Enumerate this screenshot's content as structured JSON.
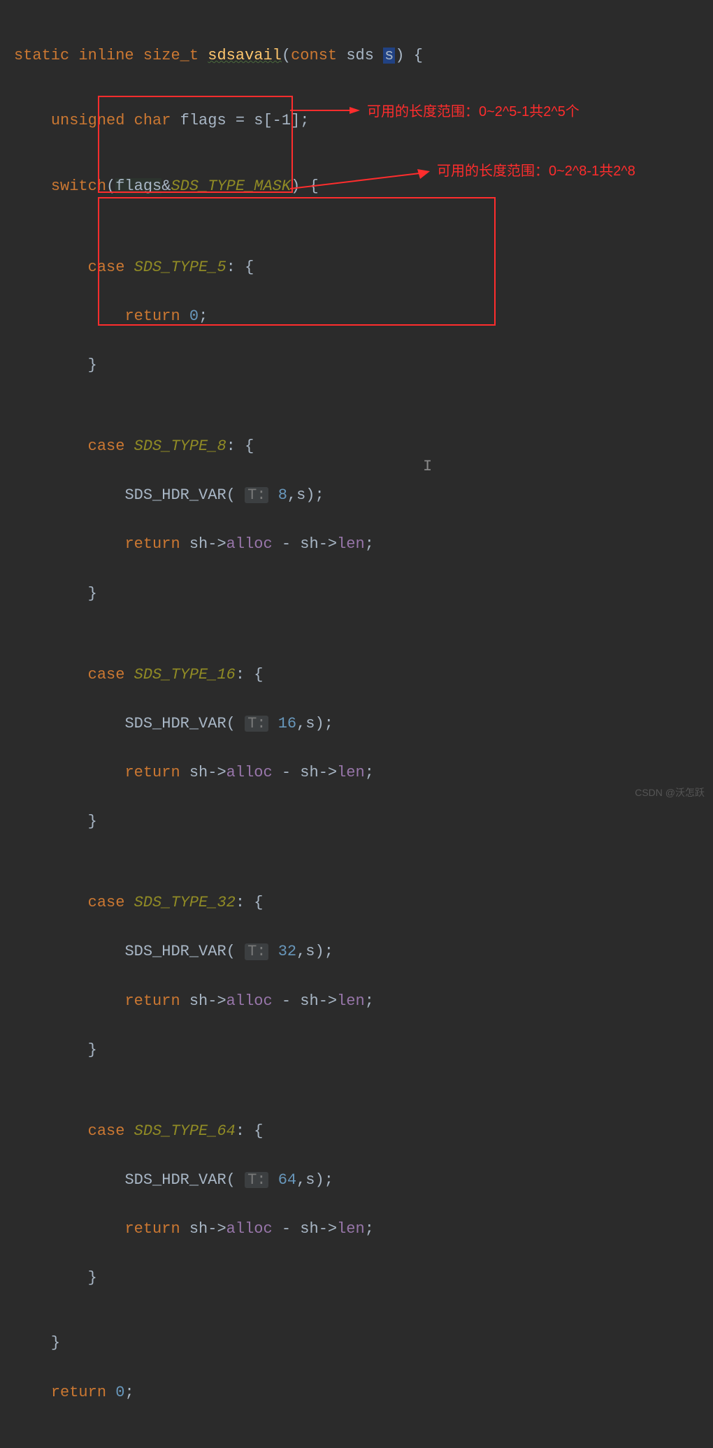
{
  "code": {
    "l1": {
      "kw_static": "static",
      "kw_inline": "inline",
      "type": "size_t",
      "fn": "sdsavail",
      "sig_open": "(",
      "kw_const": "const",
      "ptype": "sds",
      "pname": "s",
      "sig_close": ") {"
    },
    "l2": {
      "kw_unsigned": "unsigned",
      "kw_char": "char",
      "var": "flags",
      "eq": "=",
      "rhs": "s[-1];"
    },
    "l3": {
      "kw_switch": "switch",
      "open": "(",
      "v": "flags",
      "amp": "&",
      "mask": "SDS_TYPE_MASK",
      "close": ") {"
    },
    "case5": {
      "kw_case": "case",
      "label": "SDS_TYPE_5",
      "colon": ":",
      "brace": "{",
      "kw_return": "return",
      "val": "0",
      "semi": ";",
      "rbrace": "}"
    },
    "case8": {
      "kw_case": "case",
      "label": "SDS_TYPE_8",
      "colon": ": {",
      "rbrace": "}",
      "macro": "SDS_HDR_VAR",
      "hint": "T:",
      "tval": "8",
      "arg2": ",s);",
      "kw_return": "return",
      "expr_a": "sh->",
      "fld_a": "alloc",
      "minus": " - ",
      "expr_b": "sh->",
      "fld_b": "len",
      "semi": ";"
    },
    "case16": {
      "kw_case": "case",
      "label": "SDS_TYPE_16",
      "colon": ": {",
      "rbrace": "}",
      "macro": "SDS_HDR_VAR",
      "hint": "T:",
      "tval": "16",
      "arg2": ",s);",
      "kw_return": "return",
      "expr_a": "sh->",
      "fld_a": "alloc",
      "minus": " - ",
      "expr_b": "sh->",
      "fld_b": "len",
      "semi": ";"
    },
    "case32": {
      "kw_case": "case",
      "label": "SDS_TYPE_32",
      "colon": ": {",
      "rbrace": "}",
      "macro": "SDS_HDR_VAR",
      "hint": "T:",
      "tval": "32",
      "arg2": ",s);",
      "kw_return": "return",
      "expr_a": "sh->",
      "fld_a": "alloc",
      "minus": " - ",
      "expr_b": "sh->",
      "fld_b": "len",
      "semi": ";"
    },
    "case64": {
      "kw_case": "case",
      "label": "SDS_TYPE_64",
      "colon": ": {",
      "rbrace": "}",
      "macro": "SDS_HDR_VAR",
      "hint": "T:",
      "tval": "64",
      "arg2": ",s);",
      "kw_return": "return",
      "expr_a": "sh->",
      "fld_a": "alloc",
      "minus": " - ",
      "expr_b": "sh->",
      "fld_b": "len",
      "semi": ";"
    },
    "end": {
      "rbrace_switch": "}",
      "kw_return": "return",
      "val": "0",
      "semi": ";"
    }
  },
  "annotations": {
    "a1": "可用的长度范围：0~2^5-1共2^5个",
    "a2": "可用的长度范围：0~2^8-1共2^8"
  },
  "watermark": "CSDN @沃怎跃"
}
